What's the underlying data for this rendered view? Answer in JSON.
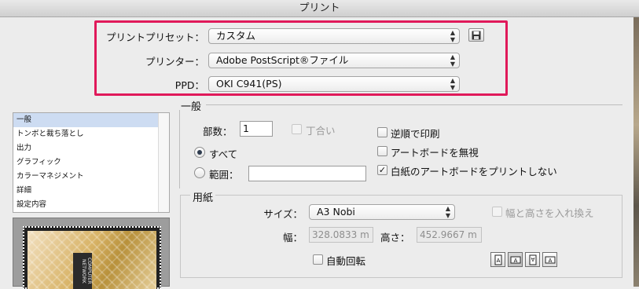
{
  "window": {
    "title": "プリント"
  },
  "presets": {
    "preset_label": "プリントプリセット：",
    "preset_value": "カスタム",
    "printer_label": "プリンター：",
    "printer_value": "Adobe PostScript®ファイル",
    "ppd_label": "PPD：",
    "ppd_value": "OKI C941(PS)",
    "highlight_color": "#e0195a"
  },
  "sidebar": {
    "items": [
      {
        "label": "一般",
        "selected": true
      },
      {
        "label": "トンボと裁ち落とし"
      },
      {
        "label": "出力"
      },
      {
        "label": "グラフィック"
      },
      {
        "label": "カラーマネジメント"
      },
      {
        "label": "詳細"
      },
      {
        "label": "設定内容"
      }
    ]
  },
  "preview": {
    "text": "COMPUTER NETWORK"
  },
  "general": {
    "title": "一般",
    "copies_label": "部数：",
    "copies_value": "1",
    "collate_label": "丁合い",
    "all_label": "すべて",
    "range_label": "範囲：",
    "range_value": "",
    "reverse_label": "逆順で印刷",
    "ignore_artboards_label": "アートボードを無視",
    "skip_blank_label": "白紙のアートボードをプリントしない",
    "skip_blank_checked": true
  },
  "media": {
    "title": "用紙",
    "size_label": "サイズ：",
    "size_value": "A3 Nobi",
    "transverse_label": "幅と高さを入れ換え",
    "width_label": "幅：",
    "width_value": "328.0833 m",
    "height_label": "高さ：",
    "height_value": "452.9667 m",
    "auto_rotate_label": "自動回転"
  },
  "icons": {
    "save": "floppy-icon",
    "orientations": [
      "portrait-icon",
      "landscape-icon",
      "portrait-flipped-icon",
      "landscape-flipped-icon"
    ]
  }
}
